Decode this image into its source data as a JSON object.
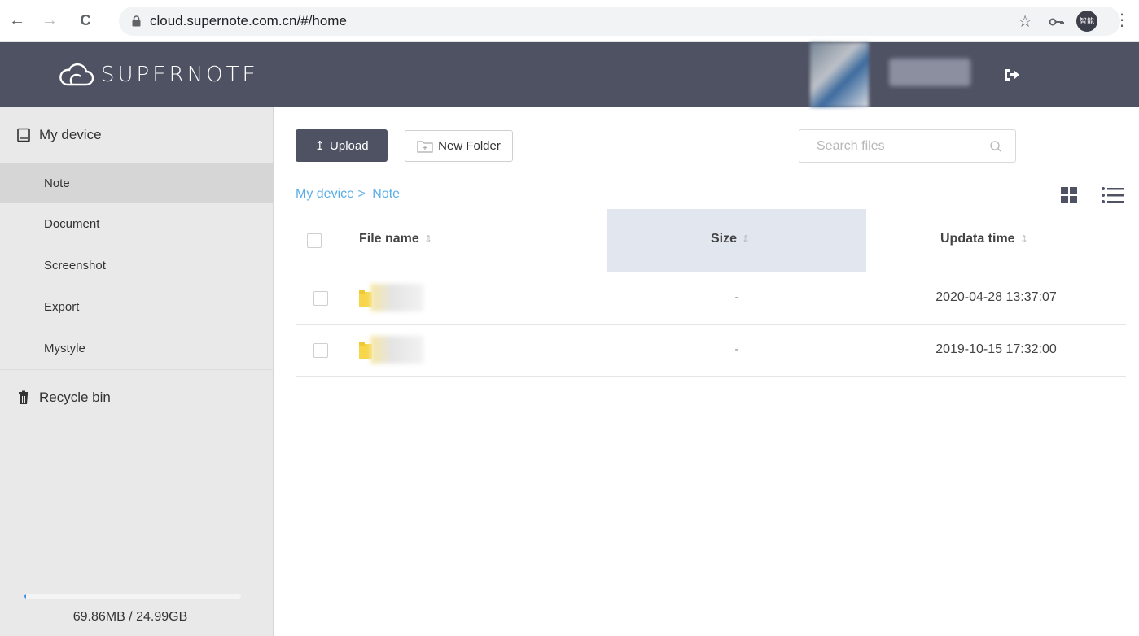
{
  "browser": {
    "back": "←",
    "forward": "→",
    "reload": "C",
    "url": "cloud.supernote.com.cn/#/home",
    "profile_label": "智能",
    "menu": "⋮"
  },
  "header": {
    "logo_text": "SUPERNOTE"
  },
  "sidebar": {
    "device_title": "My device",
    "items": [
      {
        "label": "Note",
        "active": true
      },
      {
        "label": "Document",
        "active": false
      },
      {
        "label": "Screenshot",
        "active": false
      },
      {
        "label": "Export",
        "active": false
      },
      {
        "label": "Mystyle",
        "active": false
      }
    ],
    "recycle_title": "Recycle bin",
    "storage": {
      "used_fraction": 0.003,
      "text": "69.86MB / 24.99GB"
    }
  },
  "toolbar": {
    "upload_label": "Upload",
    "new_folder_label": "New Folder",
    "search_placeholder": "Search files"
  },
  "breadcrumb": {
    "root": "My device >",
    "current": "Note"
  },
  "table": {
    "columns": {
      "name": "File name",
      "size": "Size",
      "time": "Updata time"
    },
    "sort_symbol": "⇕",
    "rows": [
      {
        "size": "-",
        "time": "2020-04-28 13:37:07"
      },
      {
        "size": "-",
        "time": "2019-10-15 17:32:00"
      }
    ]
  },
  "colors": {
    "header_bg": "#4f5263",
    "sidebar_bg": "#e9e9e9",
    "link_blue": "#5aaee8",
    "size_header_bg": "#e1e6ef"
  }
}
